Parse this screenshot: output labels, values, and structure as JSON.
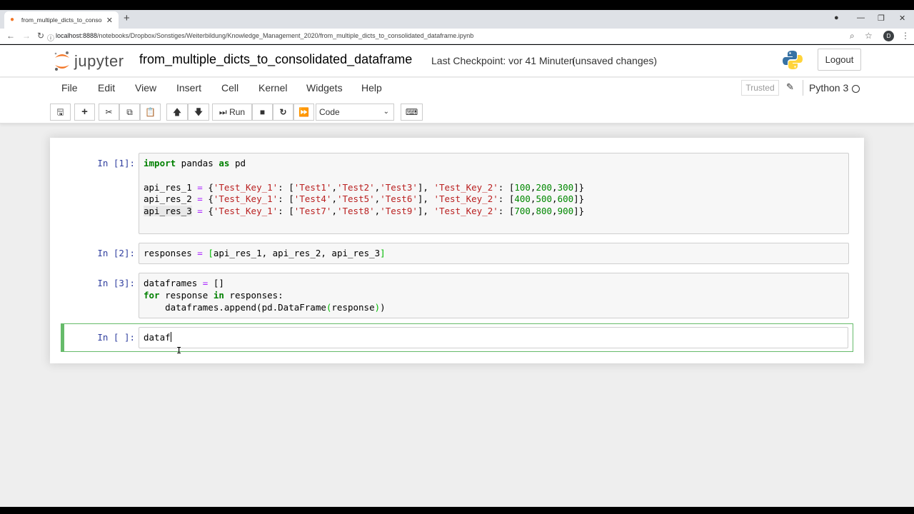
{
  "browser": {
    "tab_title": "from_multiple_dicts_to_consolid...",
    "url_host": "localhost:8888",
    "url_path": "/notebooks/Dropbox/Sonstiges/Weiterbildung/Knowledge_Management_2020/from_multiple_dicts_to_consolidated_dataframe.ipynb",
    "avatar_letter": "D"
  },
  "header": {
    "logo_text": "jupyter",
    "notebook_name": "from_multiple_dicts_to_consolidated_dataframe",
    "checkpoint": "Last Checkpoint: vor 41 Minuten",
    "autosave": "(unsaved changes)",
    "logout_label": "Logout"
  },
  "menubar": {
    "items": [
      "File",
      "Edit",
      "View",
      "Insert",
      "Cell",
      "Kernel",
      "Widgets",
      "Help"
    ],
    "trusted_label": "Trusted",
    "kernel_name": "Python 3"
  },
  "toolbar": {
    "run_label": "Run",
    "cell_type": "Code"
  },
  "cells": [
    {
      "prompt": "In [1]:"
    },
    {
      "prompt": "In [2]:"
    },
    {
      "prompt": "In [3]:"
    },
    {
      "prompt": "In [ ]:",
      "source": "dataf"
    }
  ],
  "colors": {
    "jupyter_orange": "#f37626",
    "prompt_blue": "#303f9f",
    "selected_cell_green": "#66bb6a",
    "keyword_green": "#008000",
    "string_red": "#ba2121"
  }
}
